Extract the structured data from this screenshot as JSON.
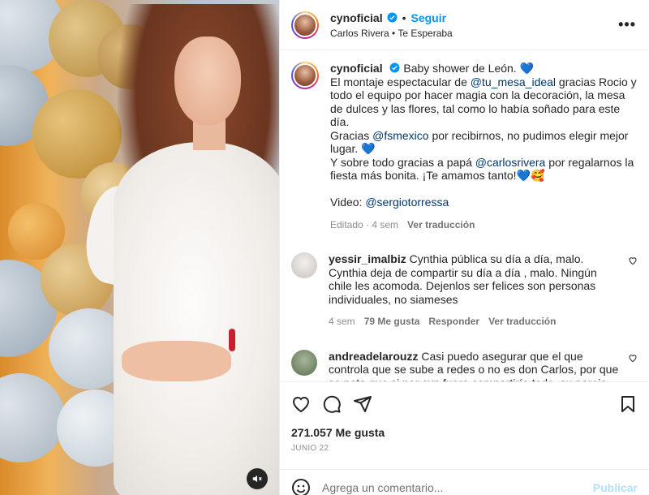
{
  "post": {
    "username": "cynoficial",
    "follow_label": "Seguir",
    "audio": "Carlos Rivera • Te Esperaba",
    "more_label": "•••"
  },
  "caption": {
    "username": "cynoficial",
    "t1": "Baby shower de León. 💙",
    "t2": "El montaje espectacular de ",
    "m1": "@tu_mesa_ideal",
    "t3": " gracias Rocio y todo el equipo por hacer magia con la decoración, la mesa de dulces y las flores, tal como lo había soñado para este día.",
    "t4": "Gracias ",
    "m2": "@fsmexico",
    "t5": " por recibirnos, no pudimos elegir mejor lugar. 💙",
    "t6": "Y sobre todo gracias a papá ",
    "m3": "@carlosrivera",
    "t7": " por regalarnos la fiesta más bonita. ¡Te amamos tanto!💙🥰",
    "t8": "Video: ",
    "m4": "@sergiotorressa",
    "edited": "Editado · 4 sem",
    "translate": "Ver traducción"
  },
  "comments": [
    {
      "username": "yessir_imalbiz",
      "text": "Cynthia pública su día a día, malo. Cynthia deja de compartir su día a día , malo. Ningún chile les acomoda. Dejenlos ser felices son personas individuales, no siameses",
      "time": "4 sem",
      "likes": "79 Me gusta",
      "reply": "Responder",
      "translate": "Ver traducción"
    },
    {
      "username": "andreadelarouzz",
      "text": "Casi puedo asegurar que el que controla que se sube a redes o no es don Carlos, por que se nota que si por cyn fuera compartiría todo, su pareja, su boda, próximamente a su bebé pero poosss no la han de dar chance"
    }
  ],
  "footer": {
    "likes": "271.057 Me gusta",
    "date": "JUNIO 22",
    "comment_placeholder": "Agrega un comentario...",
    "publish": "Publicar"
  },
  "colors": {
    "link": "#0095f6",
    "mention": "#00376b",
    "muted": "#8e8e8e"
  }
}
